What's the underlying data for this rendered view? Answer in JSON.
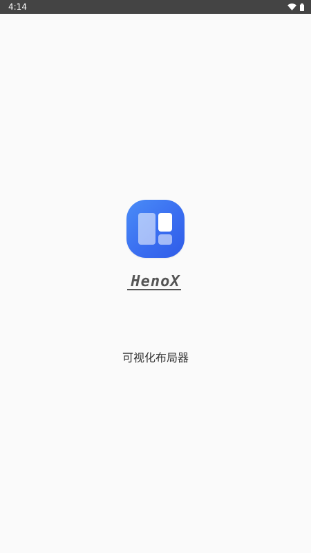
{
  "status_bar": {
    "time": "4:14",
    "icons": [
      "wifi-icon",
      "battery-icon"
    ]
  },
  "splash": {
    "app_name": "HenoX",
    "tagline": "可视化布局器"
  },
  "colors": {
    "logo_gradient_start": "#4a8cf7",
    "logo_gradient_end": "#2f5ce8",
    "wordmark": "#555555",
    "status_bar_bg": "#444444",
    "background": "#fafafa"
  }
}
